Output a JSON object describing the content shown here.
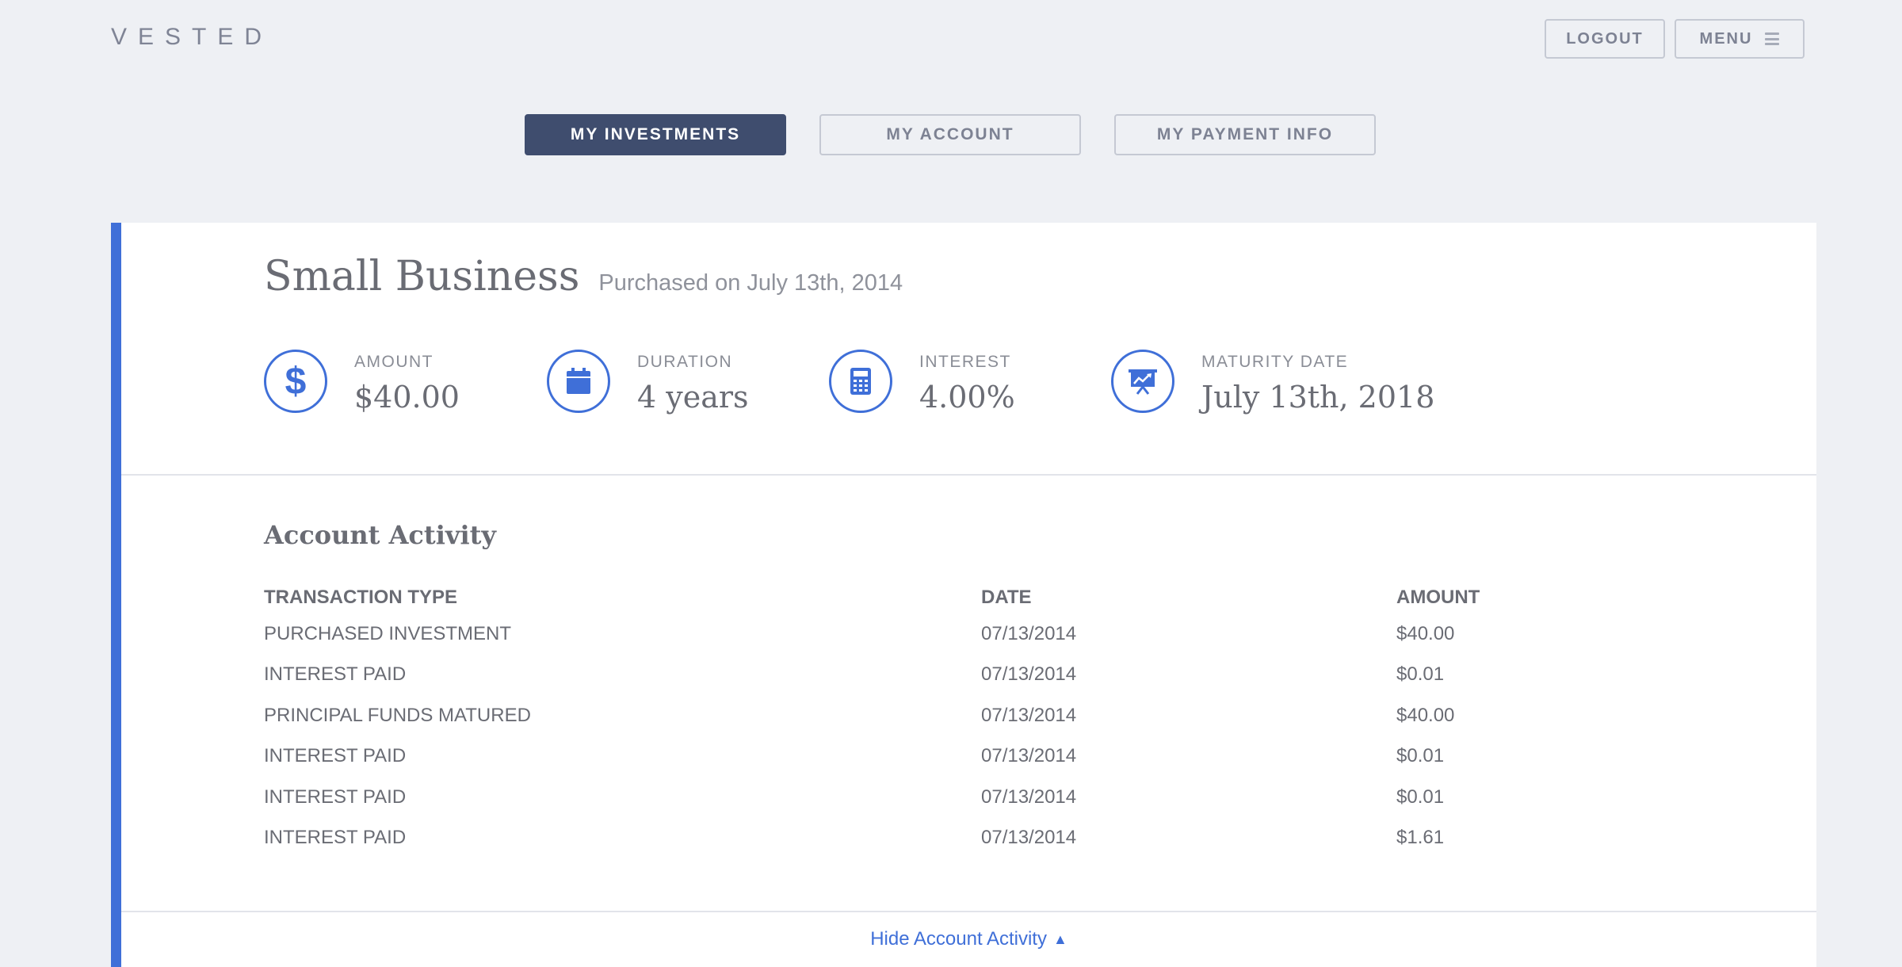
{
  "brand": "VESTED",
  "header": {
    "logout_label": "LOGOUT",
    "menu_label": "MENU"
  },
  "tabs": [
    {
      "label": "MY INVESTMENTS",
      "active": true
    },
    {
      "label": "MY ACCOUNT",
      "active": false
    },
    {
      "label": "MY PAYMENT INFO",
      "active": false
    }
  ],
  "investment": {
    "title": "Small Business",
    "subtitle": "Purchased on July 13th, 2014",
    "stats": [
      {
        "icon": "dollar-icon",
        "label": "AMOUNT",
        "value": "$40.00"
      },
      {
        "icon": "calendar-icon",
        "label": "DURATION",
        "value": "4 years"
      },
      {
        "icon": "calculator-icon",
        "label": "INTEREST",
        "value": "4.00%"
      },
      {
        "icon": "presentation-chart-icon",
        "label": "MATURITY DATE",
        "value": "July 13th, 2018"
      }
    ]
  },
  "activity": {
    "title": "Account Activity",
    "columns": [
      "TRANSACTION TYPE",
      "DATE",
      "AMOUNT"
    ],
    "rows": [
      [
        "PURCHASED INVESTMENT",
        "07/13/2014",
        "$40.00"
      ],
      [
        "INTEREST PAID",
        "07/13/2014",
        "$0.01"
      ],
      [
        "PRINCIPAL FUNDS MATURED",
        "07/13/2014",
        "$40.00"
      ],
      [
        "INTEREST PAID",
        "07/13/2014",
        "$0.01"
      ],
      [
        "INTEREST PAID",
        "07/13/2014",
        "$0.01"
      ],
      [
        "INTEREST PAID",
        "07/13/2014",
        "$1.61"
      ]
    ],
    "hide_label": "Hide Account Activity"
  },
  "colors": {
    "accent": "#3f6fd8",
    "active_tab": "#3f4d6e",
    "background": "#eef0f4"
  }
}
